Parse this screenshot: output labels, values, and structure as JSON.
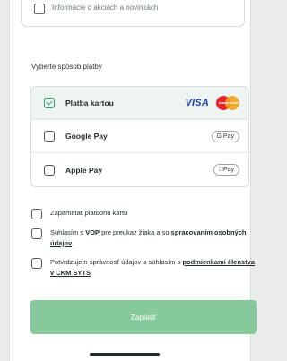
{
  "top_checkbox": {
    "text": "Informácie o akciách a novinkách"
  },
  "payment": {
    "section_label": "Vyberte spôsob platby",
    "options": [
      {
        "label": "Platba kartou",
        "selected": true,
        "badges": [
          "VISA",
          "mastercard"
        ]
      },
      {
        "label": "Google Pay",
        "selected": false,
        "badge": "G Pay"
      },
      {
        "label": "Apple Pay",
        "selected": false,
        "badge": "Pay"
      }
    ]
  },
  "consents": {
    "remember_card": "Zapamätať platobnú kartu",
    "vop": {
      "pre": "Súhlasím s ",
      "link1": "VOP",
      "mid": " pre preukaz žiaka a so ",
      "link2": "spracovaním osobných údajov",
      "post": "."
    },
    "membership": {
      "pre": "Potvrdzujem správnosť údajov a súhlasím s ",
      "link": "podmienkami členstva v CKM SYTS"
    }
  },
  "pay_button_label": "Zaplatiť",
  "colors": {
    "accent": "#2f9f63",
    "button": "#86c99a",
    "visa": "#1a3fb0"
  }
}
